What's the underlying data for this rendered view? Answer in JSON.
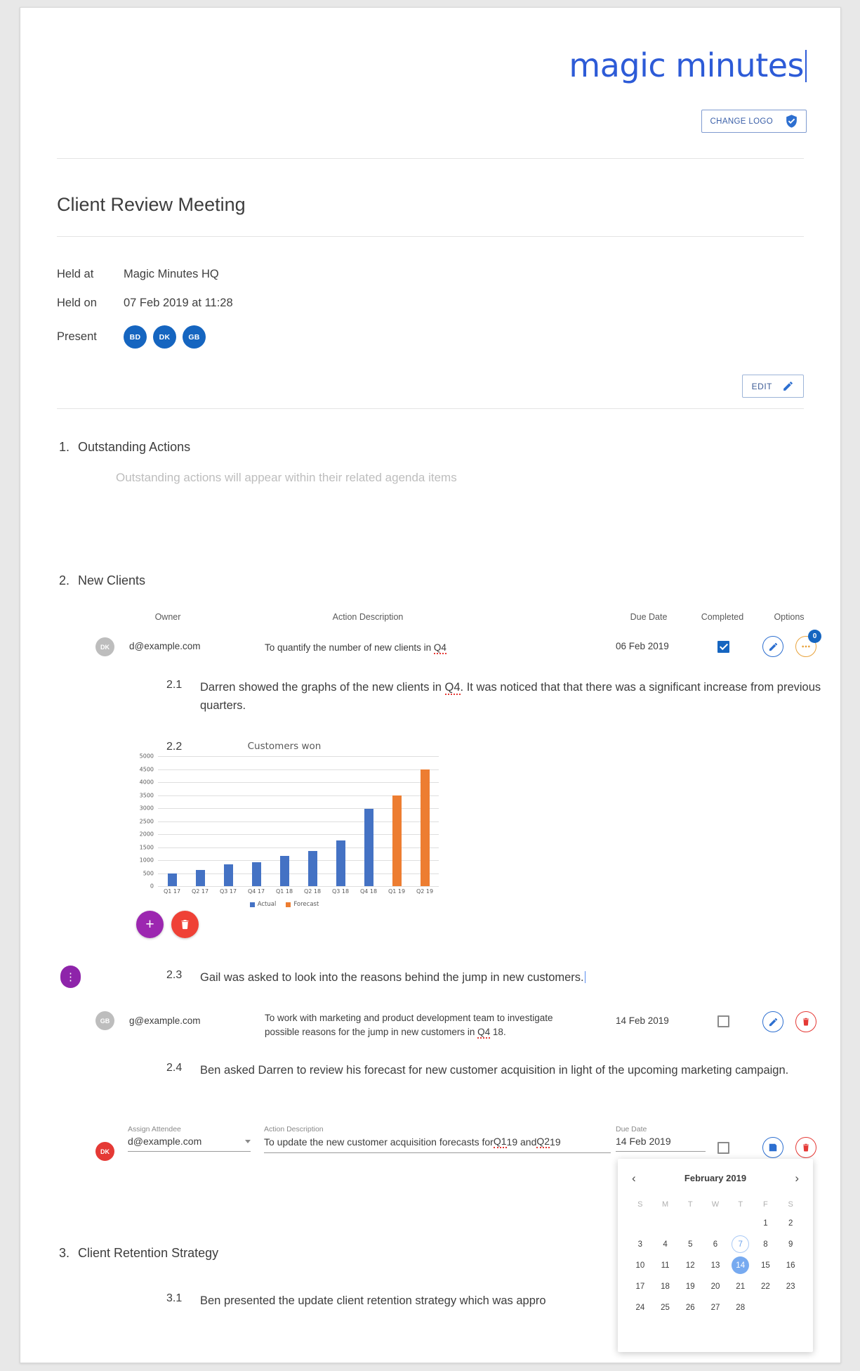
{
  "brand": {
    "name": "magic minutes",
    "color": "#2d5bd7"
  },
  "change_logo": {
    "label": "CHANGE LOGO",
    "icon": "shield-check-icon"
  },
  "meeting": {
    "title": "Client Review Meeting",
    "held_at_label": "Held at",
    "held_at_value": "Magic Minutes HQ",
    "held_on_label": "Held on",
    "held_on_value": "07 Feb 2019  at  11:28",
    "present_label": "Present",
    "attendees": [
      {
        "initials": "BD"
      },
      {
        "initials": "DK"
      },
      {
        "initials": "GB"
      }
    ]
  },
  "edit_button": {
    "label": "EDIT",
    "icon": "pencil-icon"
  },
  "sections": [
    {
      "number": "1.",
      "title": "Outstanding Actions",
      "placeholder": "Outstanding actions will appear within their related agenda items"
    },
    {
      "number": "2.",
      "title": "New Clients"
    },
    {
      "number": "3.",
      "title": "Client Retention Strategy"
    }
  ],
  "action_table": {
    "headers": {
      "owner": "Owner",
      "description": "Action Description",
      "due_date": "Due Date",
      "completed": "Completed",
      "options": "Options"
    }
  },
  "actions": [
    {
      "initials": "DK",
      "email": "d@example.com",
      "description_pre": "To quantify the number of new clients in ",
      "description_spell": "Q4",
      "description_post": "",
      "due_date": "06 Feb 2019",
      "completed": true,
      "options_badge": "0"
    },
    {
      "initials": "GB",
      "email": "g@example.com",
      "description_line1_pre": "To work with marketing and product development team to investigate",
      "description_line2_pre": "possible reasons for the jump in new customers in ",
      "description_line2_spell": "Q4",
      "description_line2_post": " 18.",
      "due_date": "14 Feb 2019",
      "completed": false
    }
  ],
  "paragraphs": {
    "p21_num": "2.1",
    "p21_text": "Darren showed the graphs of the new clients in ",
    "p21_spell": "Q4",
    "p21_text2": ".  It was noticed that that there was a significant increase from previous quarters.",
    "p22_num": "2.2",
    "p23_num": "2.3",
    "p23_text": "Gail was asked to look into the reasons behind the jump in new customers.",
    "p24_num": "2.4",
    "p24_text": "Ben asked Darren to review his forecast for new customer acquisition in light of the upcoming marketing campaign.",
    "p31_num": "3.1",
    "p31_text": "Ben presented the update client retention strategy which was appro"
  },
  "fabs": {
    "add": {
      "glyph": "+",
      "color": "#9c27b0",
      "name": "add-attachment-button"
    },
    "delete": {
      "glyph": "trash",
      "color": "#ef4136",
      "name": "delete-attachment-button"
    }
  },
  "options_tab": {
    "glyph": "⋮"
  },
  "edit_form": {
    "attendee_label": "Assign Attendee",
    "attendee_value": "d@example.com",
    "attendee_initials": "DK",
    "description_label": "Action Description",
    "description_pre": "To update the new customer acquisition forecasts for ",
    "description_spell1": "Q1",
    "description_mid": " 19 and ",
    "description_spell2": "Q2",
    "description_post": " 19",
    "due_date_label": "Due Date",
    "due_date_value": "14 Feb 2019",
    "completed": false,
    "save_icon": "save-floppy-icon",
    "delete_icon": "trash-icon"
  },
  "datepicker": {
    "month_title": "February 2019",
    "prev_glyph": "‹",
    "next_glyph": "›",
    "dow": [
      "S",
      "M",
      "T",
      "W",
      "T",
      "F",
      "S"
    ],
    "leading_blanks": 5,
    "days": [
      1,
      2,
      3,
      4,
      5,
      6,
      7,
      8,
      9,
      10,
      11,
      12,
      13,
      14,
      15,
      16,
      17,
      18,
      19,
      20,
      21,
      22,
      23,
      24,
      25,
      26,
      27,
      28
    ],
    "today": 7,
    "selected": 14
  },
  "chart_data": {
    "type": "bar",
    "title": "Customers won",
    "xlabel": "",
    "ylabel": "",
    "ylim": [
      0,
      5000
    ],
    "yticks": [
      0,
      500,
      1000,
      1500,
      2000,
      2500,
      3000,
      3500,
      4000,
      4500,
      5000
    ],
    "grid": true,
    "legend_position": "bottom",
    "categories": [
      "Q1 17",
      "Q2 17",
      "Q3 17",
      "Q4 17",
      "Q1 18",
      "Q2 18",
      "Q3 18",
      "Q4 18",
      "Q1 19",
      "Q2 19"
    ],
    "series": [
      {
        "name": "Actual",
        "color": "#4472c4",
        "values": [
          500,
          620,
          840,
          910,
          1150,
          1340,
          1760,
          2980,
          null,
          null
        ]
      },
      {
        "name": "Forecast",
        "color": "#ed7d31",
        "values": [
          null,
          null,
          null,
          null,
          null,
          null,
          null,
          null,
          3500,
          4500
        ]
      }
    ]
  }
}
